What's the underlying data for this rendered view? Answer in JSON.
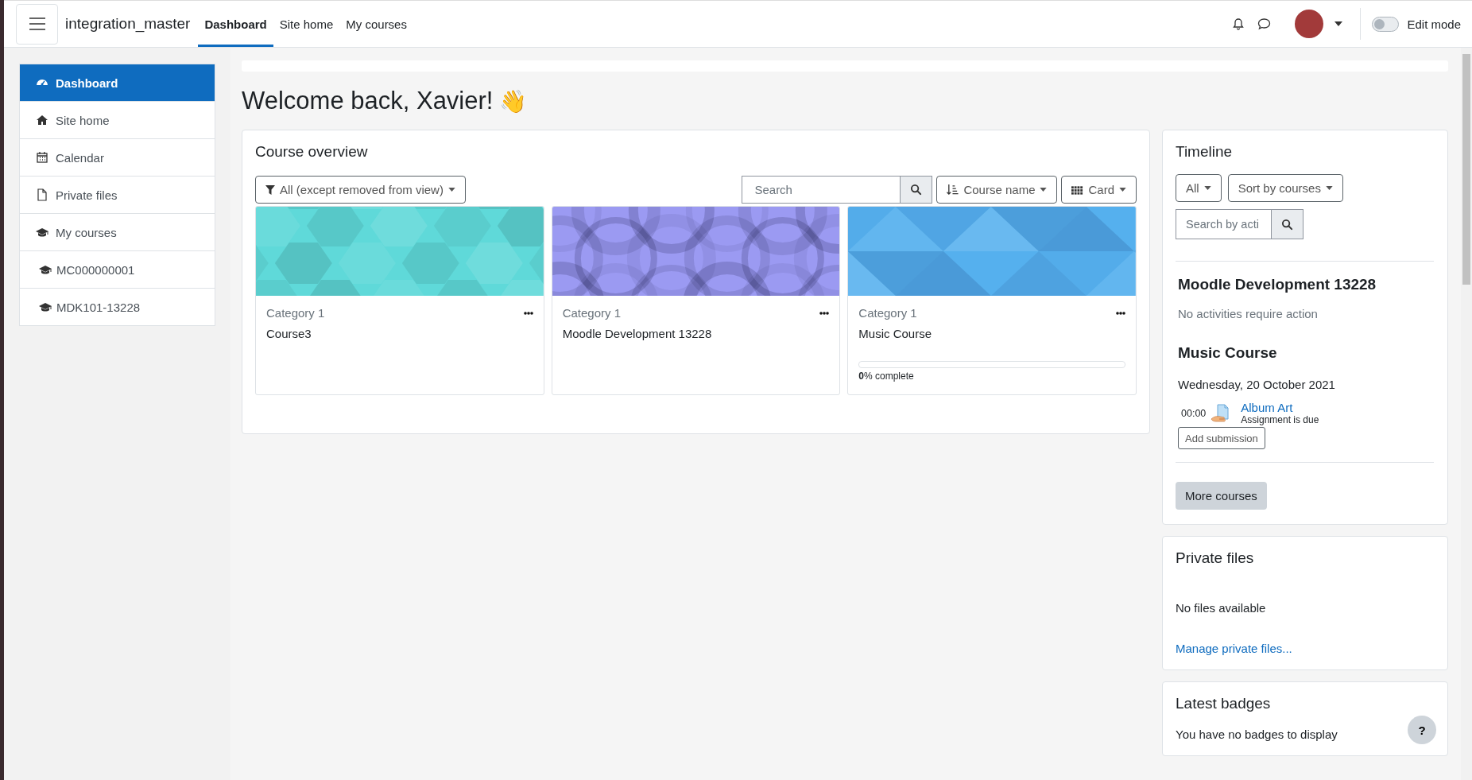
{
  "navbar": {
    "site_name": "integration_master",
    "links": [
      {
        "label": "Dashboard",
        "selected": true
      },
      {
        "label": "Site home",
        "selected": false
      },
      {
        "label": "My courses",
        "selected": false
      }
    ],
    "edit_mode": {
      "label": "Edit mode",
      "on": false
    }
  },
  "sidebar": {
    "items": [
      {
        "label": "Dashboard",
        "kind": "dashboard",
        "selected": true
      },
      {
        "label": "Site home",
        "kind": "home",
        "selected": false
      },
      {
        "label": "Calendar",
        "kind": "calendar",
        "selected": false
      },
      {
        "label": "Private files",
        "kind": "file",
        "selected": false
      },
      {
        "label": "My courses",
        "kind": "course",
        "selected": false,
        "children": [
          {
            "label": "MC000000001",
            "kind": "course",
            "selected": false
          },
          {
            "label": "MDK101-13228",
            "kind": "course",
            "selected": false
          }
        ]
      }
    ]
  },
  "page_title": "Welcome back, Xavier!",
  "page_title_emoji": "👋",
  "course_overview": {
    "title": "Course overview",
    "filter": "All (except removed from view)",
    "search_placeholder": "Search",
    "sort": "Course name",
    "view": "Card",
    "courses": [
      {
        "category": "Category 1",
        "name": "Course3",
        "kind": "hexagons",
        "color": "#5fd9d9"
      },
      {
        "category": "Category 1",
        "name": "Moodle Development 13228",
        "kind": "circles",
        "color": "#9b9af2"
      },
      {
        "category": "Category 1",
        "name": "Music Course",
        "kind": "triangles",
        "color": "#55b0ee",
        "progress": {
          "level": 0,
          "text": "**0**% complete"
        }
      }
    ]
  },
  "timeline": {
    "title": "Timeline",
    "filter": "All",
    "sort": "Sort by courses",
    "search_placeholder": "Search by acti",
    "groups": [
      {
        "course": "Moodle Development 13228",
        "empty_text": "No activities require action"
      },
      {
        "course": "Music Course",
        "date": "Wednesday, 20 October 2021",
        "events": [
          {
            "time": "00:00",
            "name": "Album Art",
            "status": "Assignment is due",
            "action": "Add submission"
          }
        ]
      }
    ],
    "more_button": "More courses"
  },
  "private_files": {
    "title": "Private files",
    "text": "No files available",
    "link": "Manage private files..."
  },
  "latest_badges": {
    "title": "Latest badges",
    "text": "You have no badges to display"
  },
  "help_button": "?"
}
